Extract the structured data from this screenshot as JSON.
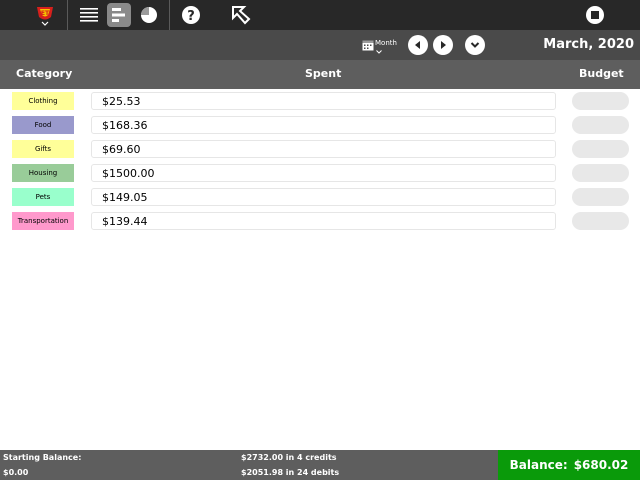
{
  "toolbar": {
    "icons": [
      "app-logo-icon",
      "list-view-icon",
      "bar-chart-view-icon",
      "pie-chart-view-icon",
      "help-icon",
      "cursor-icon",
      "stop-icon"
    ]
  },
  "subbar": {
    "period_label": "Month",
    "date_title": "March, 2020"
  },
  "table": {
    "headers": {
      "category": "Category",
      "spent": "Spent",
      "budget": "Budget"
    },
    "rows": [
      {
        "category": "Clothing",
        "spent": "$25.53",
        "color": "#ffff99"
      },
      {
        "category": "Food",
        "spent": "$168.36",
        "color": "#9999cc"
      },
      {
        "category": "Gifts",
        "spent": "$69.60",
        "color": "#ffff99"
      },
      {
        "category": "Housing",
        "spent": "$1500.00",
        "color": "#99cc99"
      },
      {
        "category": "Pets",
        "spent": "$149.05",
        "color": "#99ffcc"
      },
      {
        "category": "Transportation",
        "spent": "$139.44",
        "color": "#ff99cc"
      }
    ]
  },
  "footer": {
    "starting_balance_label": "Starting Balance:",
    "starting_balance_value": "$0.00",
    "credits": "$2732.00 in 4 credits",
    "debits": "$2051.98 in 24 debits",
    "balance_label": "Balance:",
    "balance_value": "$680.02",
    "balance_color": "#0a9a0a"
  }
}
